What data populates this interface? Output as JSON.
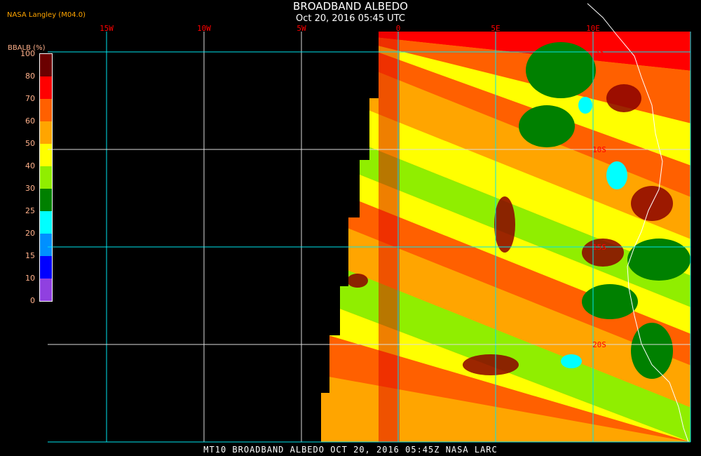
{
  "header": {
    "title": "BROADBAND ALBEDO",
    "subtitle": "Oct 20, 2016 05:45 UTC",
    "credit": "NASA Langley (M04.0)"
  },
  "colorbar": {
    "title": "BBALB (%)",
    "labels": [
      "100",
      "80",
      "70",
      "60",
      "50",
      "40",
      "30",
      "25",
      "20",
      "15",
      "10",
      "0"
    ],
    "colors": [
      "#6b0000",
      "#ff0000",
      "#ff6000",
      "#ffa500",
      "#ffff00",
      "#90ee00",
      "#008000",
      "#00ffff",
      "#0090ff",
      "#0000ff",
      "#9040e0"
    ]
  },
  "map": {
    "lon_labels": [
      "15W",
      "10W",
      "5W",
      "0",
      "5E",
      "10E"
    ],
    "lat_labels": [
      "5S",
      "10S",
      "15S",
      "20S"
    ]
  },
  "footer": "MT10  BROADBAND ALBEDO  OCT 20, 2016 05:45Z  NASA LARC"
}
